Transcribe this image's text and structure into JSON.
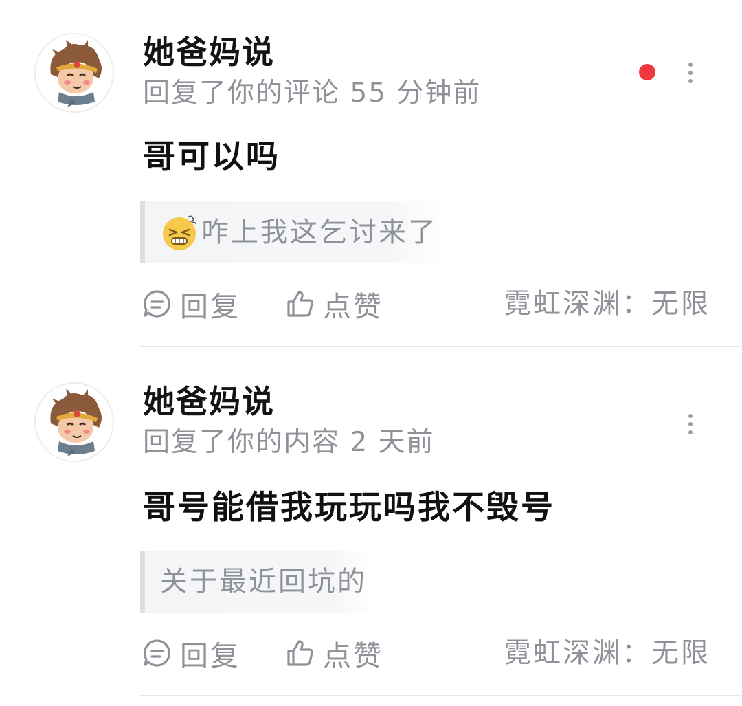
{
  "colors": {
    "unread_dot": "#f0393e",
    "meta_gray": "#8e9298",
    "quote_background": "#f4f5f7",
    "quote_border": "#dcdee2",
    "divider": "#e6e7ea"
  },
  "notifications": [
    {
      "username": "她爸妈说",
      "meta": "回复了你的评论 55 分钟前",
      "unread": true,
      "avatar_icon": "monkey-king-avatar",
      "content": "哥可以吗",
      "quote": {
        "emoji_icon": "dizzy-face-emoji",
        "text": "咋上我这乞讨来了"
      },
      "actions": {
        "reply_label": "回复",
        "like_label": "点赞"
      },
      "source": "霓虹深渊：无限"
    },
    {
      "username": "她爸妈说",
      "meta": "回复了你的内容 2 天前",
      "unread": false,
      "avatar_icon": "monkey-king-avatar",
      "content": "哥号能借我玩玩吗我不毁号",
      "quote": {
        "text": "关于最近回坑的"
      },
      "actions": {
        "reply_label": "回复",
        "like_label": "点赞"
      },
      "source": "霓虹深渊：无限"
    }
  ]
}
